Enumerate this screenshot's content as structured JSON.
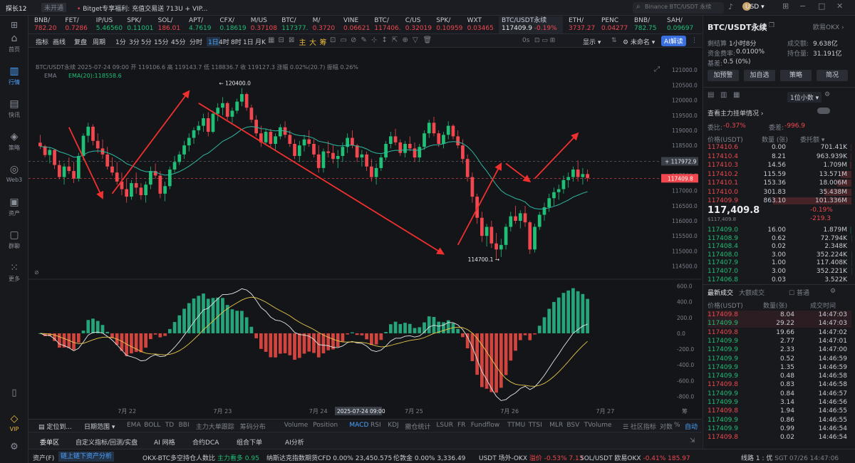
{
  "titlebar": {
    "app": "探长12",
    "badge": "未开通",
    "notice": "Bitget专享福利: 充值交易送 713U + VIP...",
    "search_placeholder": "Binance BTC/USDT 永续",
    "currency": "USD"
  },
  "nav": [
    {
      "label": "首页",
      "icon": "⌂"
    },
    {
      "label": "行情",
      "icon": "▥"
    },
    {
      "label": "快讯",
      "icon": "▤"
    },
    {
      "label": "策略",
      "icon": "◈"
    },
    {
      "label": "Web3",
      "icon": "◎"
    },
    {
      "label": "资产",
      "icon": "▣"
    },
    {
      "label": "群聊",
      "icon": "▢"
    },
    {
      "label": "更多",
      "icon": "⁙"
    }
  ],
  "nav_bottom": [
    {
      "label": "VIP",
      "icon": "◇"
    }
  ],
  "ticker": [
    {
      "name": "BNB/",
      "value": "782.20",
      "color": "red"
    },
    {
      "name": "FET/",
      "value": "0.7286",
      "color": "red"
    },
    {
      "name": "IP/US",
      "value": "5.46560",
      "color": "grn"
    },
    {
      "name": "SPK/",
      "value": "0.11001",
      "color": "grn"
    },
    {
      "name": "SOL/",
      "value": "186.01",
      "color": "red"
    },
    {
      "name": "APT/",
      "value": "4.7619",
      "color": "grn"
    },
    {
      "name": "CFX/",
      "value": "0.18619",
      "color": "grn"
    },
    {
      "name": "M/US",
      "value": "0.37108",
      "color": "red"
    },
    {
      "name": "BTC/",
      "value": "117377.",
      "color": "grn"
    },
    {
      "name": "M/",
      "value": "0.3720",
      "color": "red"
    },
    {
      "name": "VINE",
      "value": "0.06621",
      "color": "red"
    },
    {
      "name": "BTC/",
      "value": "117406.",
      "color": "red"
    },
    {
      "name": "C/US",
      "value": "0.32019",
      "color": "red"
    },
    {
      "name": "SPK/",
      "value": "0.10959",
      "color": "red"
    },
    {
      "name": "WXT",
      "value": "0.03465",
      "color": "red"
    }
  ],
  "ticker_active": {
    "name": "BTC/USDT永续",
    "price": "117409.9",
    "change": "-0.19%"
  },
  "ticker_right": [
    {
      "name": "ETH/",
      "value": "3737.27",
      "color": "red"
    },
    {
      "name": "PENC",
      "value": "0.04277",
      "color": "red"
    },
    {
      "name": "BNB/",
      "value": "782.75",
      "color": "grn"
    },
    {
      "name": "SAH/",
      "value": "0.09697",
      "color": "grn"
    }
  ],
  "toolbar": {
    "items": [
      "指标",
      "画线",
      "复盘",
      "周期",
      "1分",
      "3分",
      "5分",
      "15分",
      "45分",
      "分时",
      "1日",
      "4时",
      "8时",
      "1日",
      "月K"
    ],
    "active": "1日",
    "ratio": "0s",
    "display": "显示",
    "layout": "未命名",
    "ai": "AI解读"
  },
  "chart": {
    "symbol": "BTC/USDT永续",
    "date": "2025-07-24 09:00",
    "open": "开 119106.6",
    "high": "高 119143.7",
    "low": "低 118836.7",
    "close": "收 119127.3",
    "chg": "涨幅 0.02%(20.7)",
    "amp": "振幅 0.26%",
    "ema_label": "EMA",
    "ema_value": "EMA(20):118558.6",
    "label_high": "120400.0",
    "label_low": "114700.1",
    "price_line": "117972.9",
    "last_price": "117409.8",
    "yticks": [
      "121000.0",
      "120500.0",
      "120000.0",
      "119500.0",
      "119000.0",
      "118500.0",
      "118000.0",
      "117500.0",
      "117000.0",
      "116500.0",
      "116000.0",
      "115500.0",
      "115000.0",
      "114500.0"
    ],
    "macd_ticks": [
      "600.0",
      "400.0",
      "200.0",
      "0.0",
      "-200.0",
      "-400.0",
      "-600.0",
      "-800.0"
    ],
    "xlabels": [
      "7月 22",
      "7月 23",
      "7月 24",
      "7月 25",
      "7月 26",
      "7月 27"
    ],
    "xhighlight": "2025-07-24 09:00",
    "corner": "筹"
  },
  "indbar": {
    "left": [
      "定位到...",
      "日期范围"
    ],
    "items": [
      "EMA",
      "BOLL",
      "TD",
      "BBI",
      "主力大单跟踪",
      "筹码分布",
      "Volume",
      "Position",
      "MACD",
      "RSI",
      "KDJ",
      "撤仓统计",
      "LSUR",
      "FR",
      "Fundflow",
      "TTMU",
      "TTSI",
      "MLR",
      "BSV",
      "TVolume"
    ],
    "active": "MACD",
    "right": [
      "社区指标",
      "对数",
      "%",
      "自动"
    ]
  },
  "tabbar": [
    "委单区",
    "自定义指标/回测/实盘",
    "AI 网格",
    "合约DCA",
    "组合下单",
    "AI分析"
  ],
  "statusbar": [
    {
      "label": "资产(F)",
      "value": ""
    },
    {
      "label": "链上链下资产分析",
      "value": ""
    },
    {
      "label": "OKX-BTC多空持仓人数比",
      "value": "主力看多 0.95"
    },
    {
      "label": "纳斯达克指数期货CFD",
      "value": "0.00% 23,450.575"
    },
    {
      "label": "伦敦金",
      "value": "0.00% 3,336.49"
    },
    {
      "label": "USDT 场外-OKX",
      "value": "溢价 -0.53% 7.13"
    },
    {
      "label": "SOL/USDT 欧易OKX",
      "value": "-0.41% 185.97"
    },
    {
      "label": "线路 1 : 优",
      "value": "SGT 07/26 14:47:06"
    }
  ],
  "right_panel": {
    "title": "BTC/USDT永续",
    "exchange": "欧易OKX",
    "settle_label": "剩结算",
    "settle_value": "1小时8分",
    "vol_label": "成交额:",
    "vol_value": "9.638亿",
    "fund_label": "资金费率:",
    "fund_value": "0.0100%",
    "oi_label": "持仓量:",
    "oi_value": "31.191亿",
    "basis_label": "基差:",
    "basis_value": "0.5 (0%)",
    "buttons": [
      "加预警",
      "加自选",
      "策略",
      "简况"
    ],
    "precision": "1位小数",
    "watch": "查看主力挂单情况",
    "ratio_label": "委比:",
    "ratio_value": "-0.37%",
    "diff_label": "委差:",
    "diff_value": "-996.9",
    "ob_headers": [
      "价格(USDT)",
      "数量 (张)",
      "委托额"
    ],
    "asks": [
      [
        "117410.6",
        "0.00",
        "701.41K"
      ],
      [
        "117410.4",
        "8.21",
        "963.939K"
      ],
      [
        "117410.3",
        "14.56",
        "1.709M"
      ],
      [
        "117410.2",
        "115.59",
        "13.571M"
      ],
      [
        "117410.1",
        "153.36",
        "18.006M"
      ],
      [
        "117410.0",
        "301.83",
        "35.438M"
      ],
      [
        "117409.9",
        "863.10",
        "101.336M"
      ]
    ],
    "mid_price": "117,409.8",
    "mid_sub": "$117,409.8",
    "mid_change": "-0.19%",
    "mid_diff": "-219.3",
    "bids": [
      [
        "117409.0",
        "16.00",
        "1.879M"
      ],
      [
        "117408.9",
        "0.62",
        "72.794K"
      ],
      [
        "117408.4",
        "0.02",
        "2.348K"
      ],
      [
        "117408.0",
        "3.00",
        "352.224K"
      ],
      [
        "117407.9",
        "1.00",
        "117.408K"
      ],
      [
        "117407.0",
        "3.00",
        "352.221K"
      ],
      [
        "117406.8",
        "0.03",
        "3.522K"
      ]
    ],
    "trades_tab": "最新成交",
    "trades_tab2": "大额成交",
    "trades_opt": "普通",
    "trade_headers": [
      "价格(USDT)",
      "数量(张)",
      "成交时间"
    ],
    "trades": [
      [
        "117409.8",
        "8.04",
        "14:47:03",
        "r"
      ],
      [
        "117409.9",
        "29.22",
        "14:47:03",
        "g"
      ],
      [
        "117409.8",
        "19.66",
        "14:47:02",
        "r"
      ],
      [
        "117409.9",
        "2.77",
        "14:47:01",
        "g"
      ],
      [
        "117409.9",
        "2.33",
        "14:47:00",
        "g"
      ],
      [
        "117409.9",
        "0.52",
        "14:46:59",
        "g"
      ],
      [
        "117409.9",
        "1.35",
        "14:46:59",
        "g"
      ],
      [
        "117409.9",
        "0.48",
        "14:46:58",
        "g"
      ],
      [
        "117409.8",
        "0.83",
        "14:46:58",
        "r"
      ],
      [
        "117409.9",
        "0.84",
        "14:46:57",
        "g"
      ],
      [
        "117409.9",
        "3.14",
        "14:46:56",
        "g"
      ],
      [
        "117409.8",
        "1.94",
        "14:46:55",
        "r"
      ],
      [
        "117409.9",
        "0.86",
        "14:46:55",
        "g"
      ],
      [
        "117409.9",
        "0.99",
        "14:46:54",
        "g"
      ],
      [
        "117409.8",
        "0.02",
        "14:46:54",
        "r"
      ]
    ]
  },
  "candles": [
    [
      118590,
      118850,
      118380,
      118470
    ],
    [
      118470,
      118520,
      118100,
      118180
    ],
    [
      118180,
      118420,
      117900,
      118350
    ],
    [
      118350,
      118380,
      117720,
      117850
    ],
    [
      117850,
      118000,
      117380,
      117450
    ],
    [
      117450,
      117900,
      117200,
      117800
    ],
    [
      117800,
      118100,
      117550,
      117650
    ],
    [
      117650,
      117950,
      117250,
      117400
    ],
    [
      117400,
      118250,
      117300,
      118150
    ],
    [
      118150,
      118900,
      118000,
      118820
    ],
    [
      118820,
      119250,
      118600,
      119120
    ],
    [
      119120,
      119200,
      118500,
      118650
    ],
    [
      118650,
      118900,
      118250,
      118400
    ],
    [
      118400,
      118700,
      118050,
      118200
    ],
    [
      118200,
      118450,
      117700,
      117800
    ],
    [
      117800,
      118100,
      117500,
      117600
    ],
    [
      117600,
      117950,
      117200,
      117300
    ],
    [
      117300,
      117600,
      116850,
      117050
    ],
    [
      117050,
      117400,
      116600,
      116800
    ],
    [
      116800,
      117350,
      116700,
      117250
    ],
    [
      117250,
      117600,
      116900,
      117100
    ],
    [
      117100,
      117250,
      116700,
      116850
    ],
    [
      116850,
      117300,
      116600,
      117200
    ],
    [
      117200,
      117800,
      117050,
      117650
    ],
    [
      117650,
      117900,
      117400,
      117500
    ],
    [
      117500,
      117650,
      116750,
      116900
    ],
    [
      116900,
      117300,
      116650,
      117150
    ],
    [
      117150,
      117800,
      117050,
      117700
    ],
    [
      117700,
      118150,
      117600,
      117950
    ],
    [
      117950,
      118300,
      117850,
      118200
    ],
    [
      118200,
      118650,
      118050,
      118500
    ],
    [
      118500,
      118900,
      118300,
      118750
    ],
    [
      118750,
      119100,
      118550,
      119000
    ],
    [
      119000,
      119300,
      118850,
      119150
    ],
    [
      119150,
      119550,
      118950,
      119400
    ],
    [
      119400,
      119600,
      118800,
      118950
    ],
    [
      118950,
      119650,
      118900,
      119550
    ],
    [
      119550,
      119900,
      119300,
      119750
    ],
    [
      119750,
      120100,
      119500,
      119900
    ],
    [
      119900,
      119950,
      119350,
      119450
    ],
    [
      119450,
      119750,
      119250,
      119650
    ],
    [
      119650,
      120050,
      119550,
      119950
    ],
    [
      119950,
      120400,
      119800,
      120200
    ],
    [
      120200,
      120250,
      119650,
      119750
    ],
    [
      119750,
      119850,
      119250,
      119350
    ],
    [
      119350,
      119500,
      118800,
      118900
    ],
    [
      118900,
      119150,
      118450,
      118600
    ],
    [
      118600,
      119050,
      118500,
      118950
    ],
    [
      118950,
      119050,
      118450,
      118550
    ],
    [
      118550,
      118900,
      118350,
      118800
    ],
    [
      118800,
      119200,
      118700,
      119100
    ],
    [
      119100,
      119300,
      118750,
      118850
    ],
    [
      118850,
      119000,
      118450,
      118550
    ],
    [
      118550,
      118700,
      118050,
      118150
    ],
    [
      118150,
      118650,
      117950,
      118500
    ],
    [
      118500,
      118850,
      118300,
      118700
    ],
    [
      118700,
      119000,
      118450,
      118550
    ],
    [
      118550,
      118700,
      118100,
      118200
    ],
    [
      118200,
      118500,
      117600,
      117750
    ],
    [
      117750,
      118400,
      117600,
      118300
    ],
    [
      118300,
      118650,
      118100,
      118250
    ],
    [
      118250,
      118500,
      117900,
      118050
    ],
    [
      118050,
      118350,
      117750,
      118150
    ],
    [
      118150,
      118600,
      117950,
      118450
    ],
    [
      118450,
      118900,
      118250,
      118750
    ],
    [
      118750,
      119000,
      118400,
      118500
    ],
    [
      118500,
      118550,
      117950,
      118100
    ],
    [
      118100,
      118350,
      117800,
      118200
    ],
    [
      118200,
      118300,
      117650,
      117800
    ],
    [
      117800,
      118050,
      117300,
      117450
    ],
    [
      117450,
      117900,
      117200,
      117750
    ],
    [
      117750,
      118200,
      117650,
      118100
    ],
    [
      118100,
      118650,
      118000,
      118550
    ],
    [
      118550,
      118950,
      118400,
      118800
    ],
    [
      118800,
      119050,
      118500,
      118600
    ],
    [
      118600,
      118700,
      118150,
      118250
    ],
    [
      118250,
      118650,
      118100,
      118550
    ],
    [
      118550,
      118800,
      118300,
      118400
    ],
    [
      118400,
      118600,
      117950,
      118100
    ],
    [
      118100,
      118550,
      117950,
      118450
    ],
    [
      118450,
      119000,
      118350,
      118900
    ],
    [
      118900,
      119350,
      118750,
      119250
    ],
    [
      119250,
      119450,
      118800,
      118900
    ],
    [
      118900,
      119000,
      118450,
      118550
    ],
    [
      118550,
      118950,
      118400,
      118850
    ],
    [
      118850,
      119300,
      118700,
      119150
    ],
    [
      119150,
      119200,
      118700,
      118800
    ],
    [
      118800,
      119000,
      118400,
      118500
    ],
    [
      118500,
      118700,
      117900,
      118050
    ],
    [
      118050,
      118200,
      117300,
      117450
    ],
    [
      117450,
      117600,
      116600,
      116800
    ],
    [
      116800,
      116900,
      115900,
      116100
    ],
    [
      116100,
      116300,
      115300,
      115500
    ],
    [
      115500,
      115900,
      115150,
      115800
    ],
    [
      115800,
      116000,
      115100,
      115250
    ],
    [
      115250,
      115600,
      114700,
      115050
    ],
    [
      115050,
      115400,
      114800,
      115200
    ],
    [
      115200,
      115900,
      115050,
      115800
    ],
    [
      115800,
      116300,
      115650,
      116150
    ],
    [
      116150,
      116500,
      115900,
      116000
    ],
    [
      116000,
      116350,
      115750,
      116250
    ],
    [
      116250,
      116500,
      115800,
      115950
    ],
    [
      115950,
      116000,
      114900,
      115050
    ],
    [
      115050,
      115900,
      114950,
      115800
    ],
    [
      115800,
      116300,
      115700,
      116200
    ],
    [
      116200,
      116600,
      116000,
      116450
    ],
    [
      116450,
      116900,
      116300,
      116750
    ],
    [
      116750,
      117100,
      116500,
      116950
    ],
    [
      116950,
      117200,
      116700,
      117050
    ],
    [
      117050,
      117500,
      116900,
      117350
    ],
    [
      117350,
      117600,
      117100,
      117450
    ],
    [
      117450,
      117800,
      117300,
      117700
    ],
    [
      117700,
      118000,
      117300,
      117450
    ],
    [
      117450,
      117750,
      117200,
      117550
    ],
    [
      117550,
      117700,
      117300,
      117420
    ]
  ]
}
